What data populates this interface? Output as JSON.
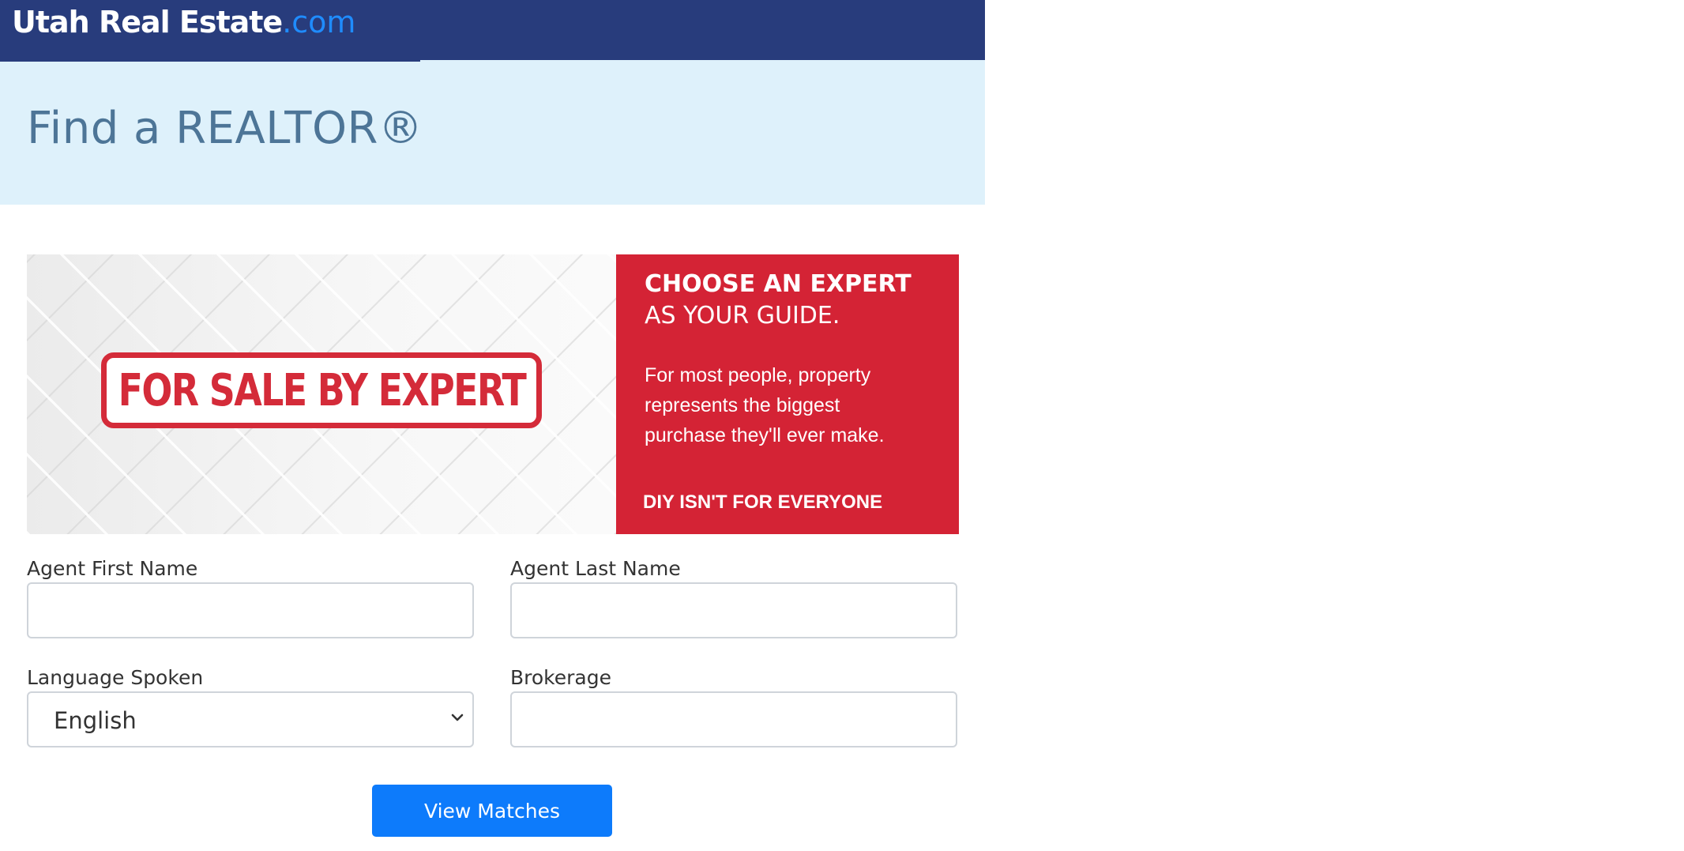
{
  "header": {
    "logo_main": "Utah Real Estate",
    "logo_tld": ".com"
  },
  "hero": {
    "title": "Find a REALTOR®"
  },
  "banner": {
    "sign_text": "FOR SALE BY EXPERT",
    "heading": "CHOOSE AN EXPERT",
    "subheading": "AS YOUR GUIDE.",
    "body": "For most people, property represents the biggest purchase they'll ever make.",
    "tagline": "DIY ISN'T FOR EVERYONE",
    "accent_color": "#d42335"
  },
  "form": {
    "first_name": {
      "label": "Agent First Name",
      "value": ""
    },
    "last_name": {
      "label": "Agent Last Name",
      "value": ""
    },
    "language": {
      "label": "Language Spoken",
      "selected": "English"
    },
    "brokerage": {
      "label": "Brokerage",
      "value": ""
    },
    "submit_label": "View Matches"
  },
  "colors": {
    "header_bg": "#283c7c",
    "hero_bg": "#def1fb",
    "button_bg": "#0d7bfb"
  }
}
